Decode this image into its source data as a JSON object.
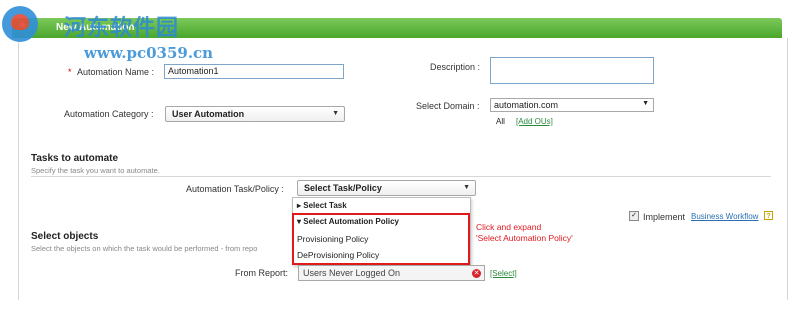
{
  "window": {
    "title": "New Automation"
  },
  "watermark": {
    "cn_text": "河东软件园",
    "url": "www.pc0359.cn"
  },
  "form": {
    "automation_name_label": "Automation Name :",
    "automation_name_required": "*",
    "automation_name_value": "Automation1",
    "description_label": "Description :",
    "category_label": "Automation Category :",
    "category_value": "User Automation",
    "domain_label": "Select Domain :",
    "domain_value": "automation.com",
    "domain_all": "All",
    "add_ous_link": "[Add OUs]"
  },
  "tasks": {
    "title": "Tasks to automate",
    "subtitle": "Specify the task you want to automate.",
    "task_policy_label": "Automation Task/Policy :",
    "task_policy_value": "Select Task/Policy",
    "dropdown": {
      "select_task": "Select Task",
      "select_policy": "Select Automation Policy",
      "items": [
        "Provisioning Policy",
        "DeProvisioning Policy"
      ]
    },
    "annotation": [
      "Click and expand",
      "'Select Automation Policy'"
    ],
    "implement_label": "Implement",
    "workflow_link": "Business Workflow",
    "help_icon": "?"
  },
  "objects": {
    "title": "Select objects",
    "subtitle": "Select the objects on which the task would be performed - from repo",
    "from_report_label": "From Report:",
    "from_report_value": "Users Never Logged On",
    "select_link": "[Select]"
  },
  "colors": {
    "header": "#4aa62c",
    "accent_red": "#e0191d",
    "link": "#2b8a3e"
  },
  "icons": {
    "arrow": "chevron-down-icon",
    "clear": "clear-icon",
    "check": "checkbox-icon",
    "help": "help-icon"
  }
}
